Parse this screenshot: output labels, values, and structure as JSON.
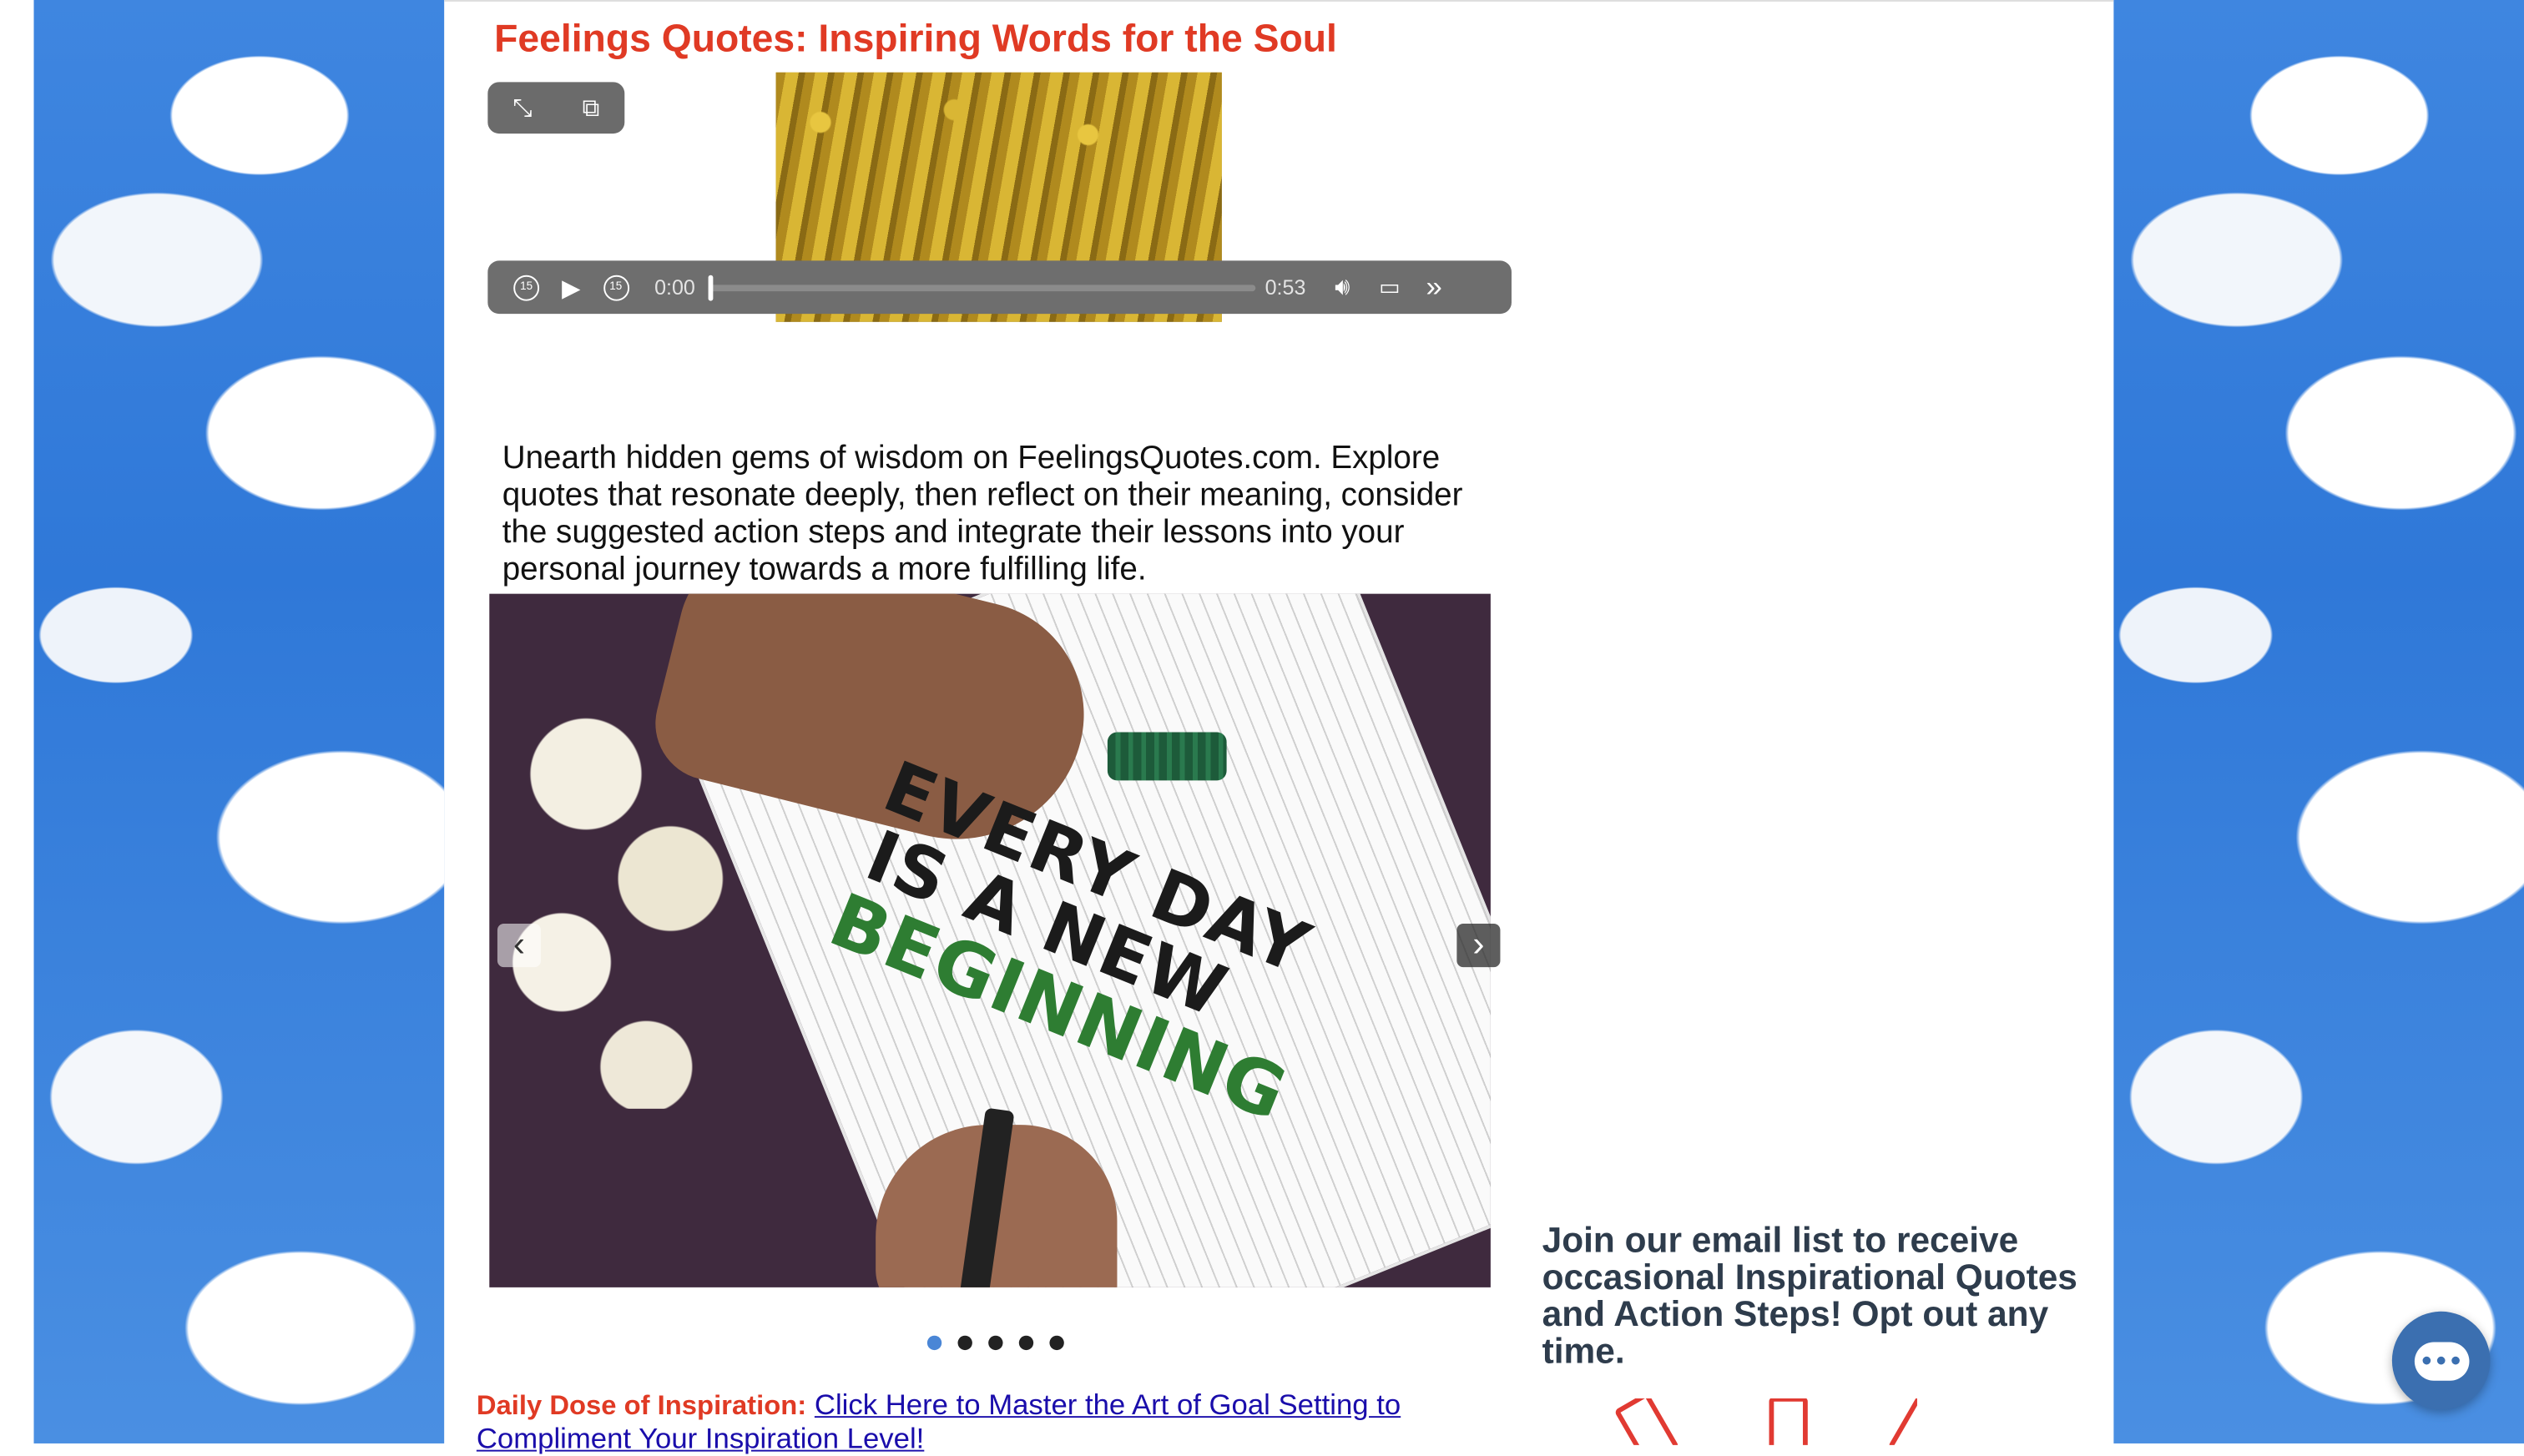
{
  "page": {
    "title": "Feelings Quotes: Inspiring Words for the Soul"
  },
  "player": {
    "current_time": "0:00",
    "duration": "0:53",
    "skip_back_label": "15",
    "skip_forward_label": "15",
    "progress": 0
  },
  "intro": {
    "text": "Unearth hidden gems of wisdom on FeelingsQuotes.com. Explore quotes that resonate deeply, then reflect on their meaning, consider the suggested action steps and integrate their lessons into your personal journey towards a more fulfilling life."
  },
  "slider": {
    "slide_text": [
      "EVERY DAY",
      "IS A NEW",
      "BEGINNING"
    ],
    "dots": [
      {
        "active": true
      },
      {
        "active": false
      },
      {
        "active": false
      },
      {
        "active": false
      },
      {
        "active": false
      }
    ]
  },
  "inspiration": {
    "label": "Daily Dose of Inspiration:",
    "link_text": "Click Here to Master the Art of Goal Setting to Compliment Your Inspiration Level!"
  },
  "sidebar": {
    "email_cta": "Join our email list to receive occasional Inspirational Quotes and Action Steps! Opt out any time."
  },
  "colors": {
    "title": "#e03a24",
    "link": "#1a0dab",
    "chat_button": "#3b6fb0",
    "active_dot": "#4a86d6"
  },
  "icons": {
    "fullscreen": "fullscreen-icon",
    "pip": "picture-in-picture-icon",
    "play": "play-icon",
    "volume": "volume-icon",
    "airplay": "airplay-icon",
    "more": "more-icon",
    "chat": "chat-icon"
  }
}
